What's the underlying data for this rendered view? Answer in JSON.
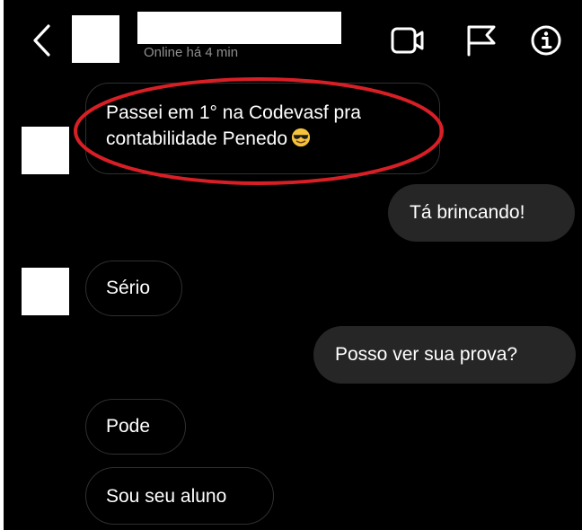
{
  "header": {
    "status": "Online há 4 min",
    "icons": {
      "back": "chevron-left-icon",
      "video": "video-call-icon",
      "flag": "flag-icon",
      "info": "info-icon"
    }
  },
  "messages": [
    {
      "side": "in",
      "line1": "Passei em 1° na Codevasf pra",
      "line2": "contabilidade Penedo",
      "emoji": "smiling-face-with-sunglasses"
    },
    {
      "side": "out",
      "text": "Tá brincando!"
    },
    {
      "side": "in",
      "text": "Sério"
    },
    {
      "side": "out",
      "text": "Posso ver sua prova?"
    },
    {
      "side": "in",
      "text": "Pode"
    },
    {
      "side": "in",
      "text": "Sou seu aluno"
    }
  ],
  "colors": {
    "background": "#000000",
    "outgoing_bubble": "#262626",
    "incoming_border": "#2f2f2f",
    "status_text": "#8e8e8e",
    "highlight_annotation": "#d91f26"
  }
}
